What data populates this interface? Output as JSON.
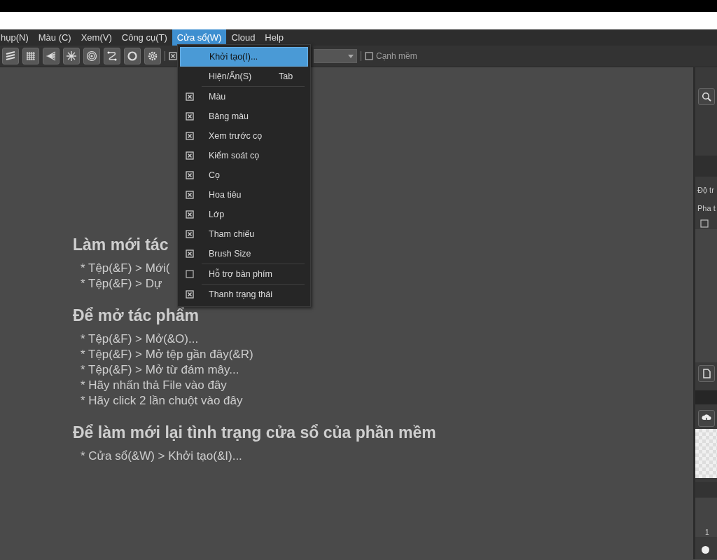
{
  "menubar": [
    {
      "label": "hụp(N)",
      "selected": false
    },
    {
      "label": "Màu (C)",
      "selected": false
    },
    {
      "label": "Xem(V)",
      "selected": false
    },
    {
      "label": "Công cụ(T)",
      "selected": false
    },
    {
      "label": "Cửa sổ(W)",
      "selected": true
    },
    {
      "label": "Cloud",
      "selected": false
    },
    {
      "label": "Help",
      "selected": false
    }
  ],
  "toolbar": {
    "option_checked": true,
    "soft_edge": {
      "label": "Cạnh mềm",
      "checked": false
    }
  },
  "window_menu": [
    {
      "kind": "action",
      "label": "Khởi tạo(I)...",
      "selected": true
    },
    {
      "kind": "action",
      "label": "Hiện/Ẩn(S)",
      "shortcut": "Tab",
      "selected": false
    },
    {
      "kind": "separator"
    },
    {
      "kind": "check",
      "label": "Màu",
      "checked": true,
      "selected": false
    },
    {
      "kind": "check",
      "label": "Bảng màu",
      "checked": true,
      "selected": false
    },
    {
      "kind": "check",
      "label": "Xem trước cọ",
      "checked": true,
      "selected": false
    },
    {
      "kind": "check",
      "label": "Kiểm soát cọ",
      "checked": true,
      "selected": false
    },
    {
      "kind": "check",
      "label": "Cọ",
      "checked": true,
      "selected": false
    },
    {
      "kind": "check",
      "label": "Hoa tiêu",
      "checked": true,
      "selected": false
    },
    {
      "kind": "check",
      "label": "Lớp",
      "checked": true,
      "selected": false
    },
    {
      "kind": "check",
      "label": "Tham chiếu",
      "checked": true,
      "selected": false
    },
    {
      "kind": "check",
      "label": "Brush Size",
      "checked": true,
      "selected": false
    },
    {
      "kind": "separator"
    },
    {
      "kind": "check",
      "label": "Hỗ trợ bàn phím",
      "checked": false,
      "selected": false
    },
    {
      "kind": "separator"
    },
    {
      "kind": "check",
      "label": "Thanh trạng thái",
      "checked": true,
      "selected": false
    }
  ],
  "sections": [
    {
      "heading": "Làm mới tác",
      "lines": [
        "* Tệp(&F) > Mới(",
        "* Tệp(&F) > Dự"
      ]
    },
    {
      "heading": "Để mở tác phẩm",
      "lines": [
        "* Tệp(&F) > Mở(&O)...",
        "* Tệp(&F) > Mở tệp gần đây(&R)",
        "* Tệp(&F) > Mở từ đám mây...",
        "* Hãy nhấn thả File vào đây",
        "* Hãy click 2 lần chuột vào đây"
      ]
    },
    {
      "heading": "Để làm mới lại tình trạng cửa sổ của phần mềm",
      "lines": [
        "* Cửa sổ(&W) > Khởi tạo(&I)..."
      ]
    }
  ],
  "right_panel": {
    "labels": [
      "Độ tr",
      "Pha t"
    ],
    "checkbox_checked": false,
    "page_number": "1"
  }
}
